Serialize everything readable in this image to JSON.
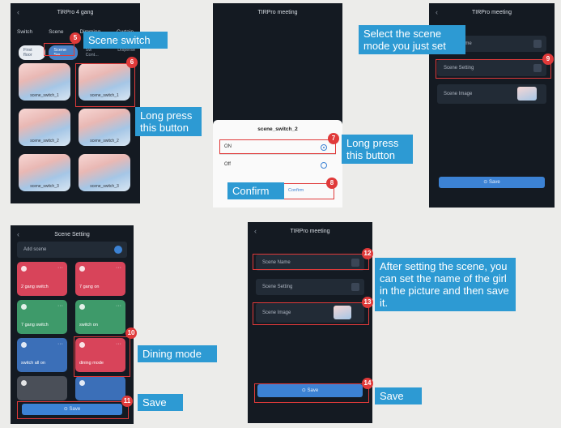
{
  "panel1": {
    "title": "TiRPro 4 gang",
    "tabs": [
      "Switch",
      "Scene",
      "Dimming",
      "Curtain"
    ],
    "chips": [
      "First floor",
      "Scene Sw",
      "Sw Cont...",
      "Disperse"
    ],
    "tiles": [
      "scene_switch_1",
      "scene_switch_1",
      "scene_switch_2",
      "scene_switch_2",
      "scene_switch_3",
      "scene_switch_3"
    ]
  },
  "panel2": {
    "title": "TIRPro meeting",
    "dialog_title": "scene_switch_2",
    "option_on": "ON",
    "option_off": "Off",
    "confirm_label": "Confirm"
  },
  "panel3": {
    "title": "TIRPro meeting",
    "rows": [
      "Scene Name",
      "Scene Setting",
      "Scene Image"
    ],
    "save_label": "Save"
  },
  "panel4": {
    "title": "Scene Setting",
    "add_scene": "Add scene",
    "cards": [
      {
        "name": "2 gang switch",
        "color": "#d8445a"
      },
      {
        "name": "7 gang on",
        "color": "#d8445a"
      },
      {
        "name": "7 gang switch",
        "color": "#3e9a6a"
      },
      {
        "name": "switch on",
        "color": "#3e9a6a"
      },
      {
        "name": "switch all on",
        "color": "#3b6fb8"
      },
      {
        "name": "dining mode",
        "color": "#d8445a"
      },
      {
        "name": "",
        "color": "#4a4f58"
      },
      {
        "name": "",
        "color": "#3b6fb8"
      }
    ],
    "save_label": "Save"
  },
  "panel5": {
    "title": "TIRPro meeting",
    "rows": [
      "Scene Name",
      "Scene Setting",
      "Scene Image"
    ],
    "save_label": "Save"
  },
  "callouts": {
    "scene_switch": "Scene switch",
    "long_press_1": "Long press this button",
    "long_press_2": "Long press this button",
    "confirm": "Confirm",
    "select_scene": "Select the scene mode you just set",
    "dining_mode": "Dining mode",
    "save_1": "Save",
    "after_setting": "After setting the scene, you can set the name of the girl in the picture and then save it.",
    "save_2": "Save"
  },
  "badges": [
    "5",
    "6",
    "7",
    "8",
    "9",
    "10",
    "11",
    "12",
    "13",
    "14"
  ],
  "colors": {
    "callout": "#2d9ad3",
    "badge": "#e03a3a",
    "accent": "#3c82d4"
  }
}
